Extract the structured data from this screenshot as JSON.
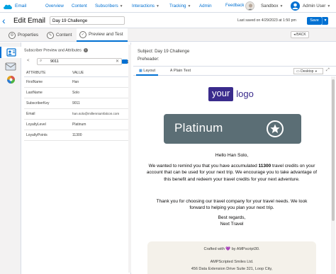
{
  "app": {
    "brand": "Email",
    "nav": [
      {
        "label": "Overview",
        "has_menu": false
      },
      {
        "label": "Content",
        "has_menu": false
      },
      {
        "label": "Subscribers",
        "has_menu": true
      },
      {
        "label": "Interactions",
        "has_menu": true
      },
      {
        "label": "Tracking",
        "has_menu": true
      },
      {
        "label": "Admin",
        "has_menu": false
      }
    ],
    "feedback": "Feedback",
    "sandbox": "Sandbox",
    "user": "Admin User",
    "accent_color": "#0070d2"
  },
  "header": {
    "title": "Edit Email",
    "email_name": "Day 19 Challenge",
    "last_saved": "Last saved on 4/29/2023 at 1:50 pm",
    "save_label": "Save"
  },
  "tabs": [
    {
      "label": "Properties",
      "icon": "gear-icon"
    },
    {
      "label": "Content",
      "icon": "pencil-icon"
    },
    {
      "label": "Preview and Test",
      "icon": "check-icon",
      "active": true
    }
  ],
  "back_label": "◂ BACK",
  "subscriber_panel": {
    "heading": "Subscriber Preview and Attributes",
    "search_value": "9011",
    "columns": [
      "ATTRIBUTE",
      "VALUE"
    ],
    "rows": [
      [
        "FirstName",
        "Han"
      ],
      [
        "LastName",
        "Solo"
      ],
      [
        "SubscriberKey",
        "9011"
      ],
      [
        "Email",
        "han.solo@millenniumfalcon.com"
      ],
      [
        "LoyaltyLevel",
        "Platinum"
      ],
      [
        "LoyaltyPoints",
        "11300"
      ]
    ]
  },
  "preview": {
    "subject_label": "Subject:",
    "subject": "Day 19 Challenge",
    "preheader_label": "Preheader:",
    "tab_layout": "Layout",
    "tab_plaintext": "Plain Text",
    "device": "Desktop",
    "email": {
      "logo_box": "your",
      "logo_text": "logo",
      "banner": "Platinum",
      "greeting": "Hello Han Solo,",
      "p1_a": "We wanted to remind you that you have accumulated ",
      "p1_points": "11300",
      "p1_b": " travel credits on your account that can be used for your next trip. We encourage you to take advantage of this benefit and redeem your travel credits for your next adventure.",
      "p2": "Thank you for choosing our travel company for your travel needs. We look forward to helping you plan your next trip.",
      "closing": "Best regards,",
      "signoff": "Next Travel",
      "footer_made": "Crafted with 💜 by AMPscript30.",
      "footer_company": "AMPScripted Smiles Ltd.",
      "footer_address": "456 Data Extension Drive Suite 321, Loop City,"
    }
  }
}
